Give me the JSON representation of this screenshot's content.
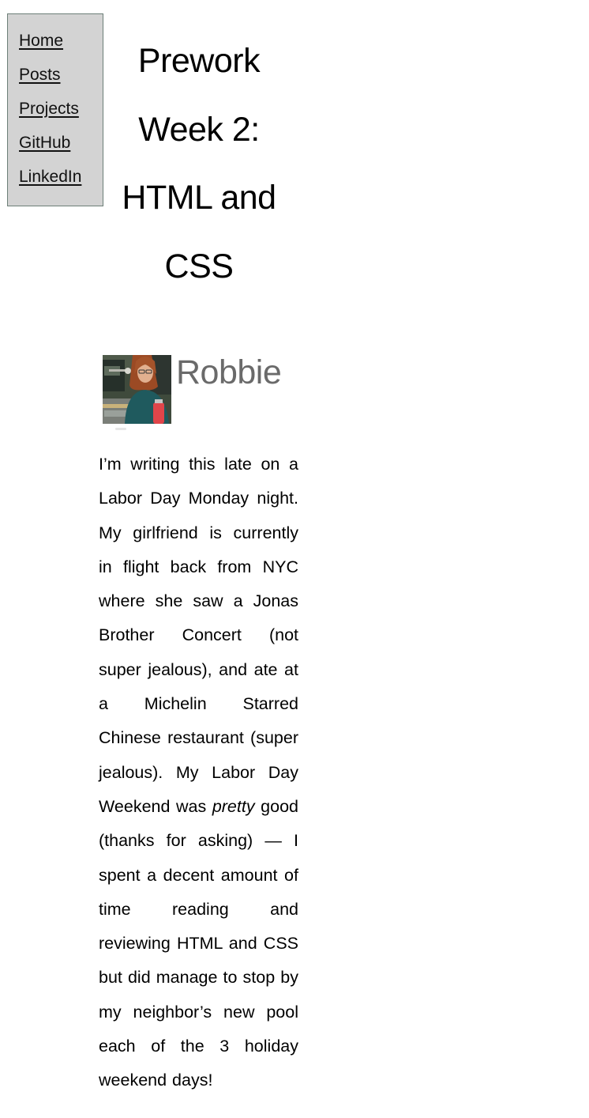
{
  "nav": {
    "items": [
      {
        "label": "Home"
      },
      {
        "label": "Posts"
      },
      {
        "label": "Projects"
      },
      {
        "label": "GitHub"
      },
      {
        "label": "LinkedIn"
      }
    ]
  },
  "post": {
    "title": "Prework Week 2: HTML and CSS",
    "author": "Robbie",
    "body": {
      "part1": "I’m writing this late on a Labor Day Monday night. My girlfriend is currently in flight back from NYC where she saw a Jonas Brother Concert (not super jealous), and ate at a Michelin Starred Chinese restaurant (super jealous). My Labor Day Weekend was ",
      "emphasis": "pretty",
      "part2": " good (thanks for asking) — I spent a decent amount of time reading and reviewing HTML and CSS but did manage to stop by my neighbor’s new pool each of the 3 holiday weekend days!"
    }
  },
  "colors": {
    "nav_background": "#d3d3d3",
    "nav_border": "#6d7f78",
    "author_name": "#6a6a6a"
  }
}
